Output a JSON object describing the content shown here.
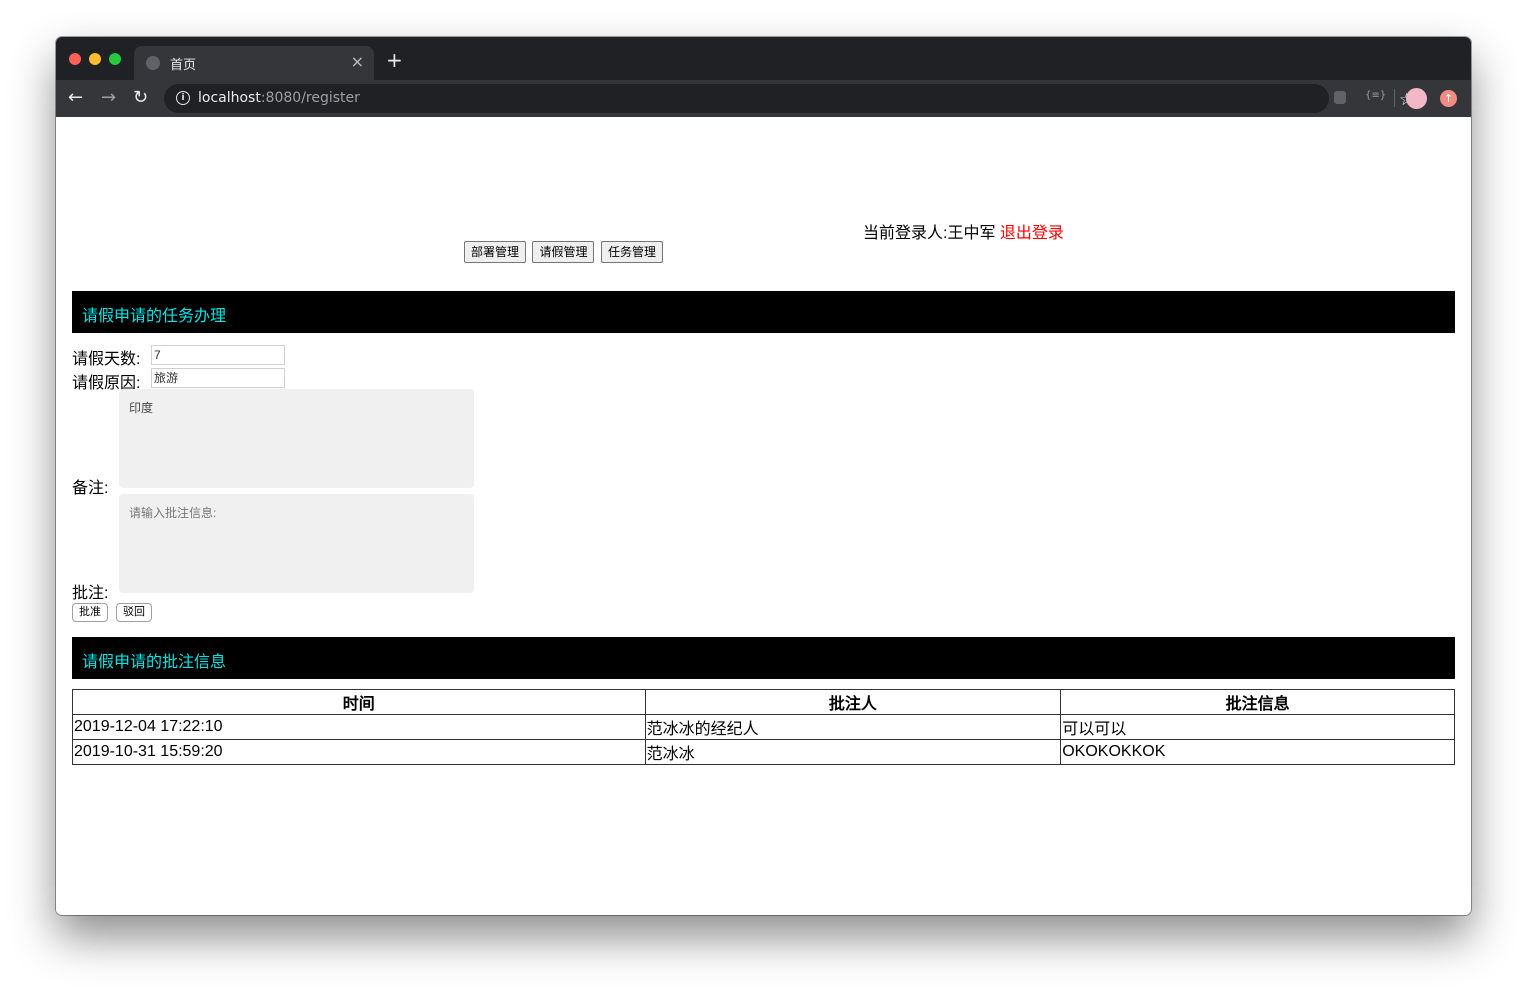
{
  "browser": {
    "tab_title": "首页",
    "tab_close": "×",
    "new_tab": "+",
    "url_host": "localhost",
    "url_rest": ":8080/register",
    "back": "←",
    "forward": "→",
    "reload": "↻",
    "info": "i",
    "star": "☆",
    "ext_label": "{≡}",
    "update": "↑"
  },
  "header": {
    "login_prefix": "当前登录人:",
    "user_name": "王中军",
    "logout": "退出登录",
    "menu": [
      "部署管理",
      "请假管理",
      "任务管理"
    ]
  },
  "task_section": {
    "title": "请假申请的任务办理",
    "days_label": "请假天数:",
    "days_value": "7",
    "reason_label": "请假原因:",
    "reason_value": "旅游",
    "remark_label": "备注:",
    "remark_value": "印度",
    "comment_label": "批注:",
    "comment_placeholder": "请输入批注信息:",
    "approve_button": "批准",
    "reject_button": "驳回"
  },
  "comment_section": {
    "title": "请假申请的批注信息",
    "columns": [
      "时间",
      "批注人",
      "批注信息"
    ],
    "rows": [
      [
        "2019-12-04 17:22:10",
        "范冰冰的经纪人",
        "可以可以"
      ],
      [
        "2019-10-31 15:59:20",
        "范冰冰",
        "OKOKOKKOK"
      ]
    ]
  }
}
